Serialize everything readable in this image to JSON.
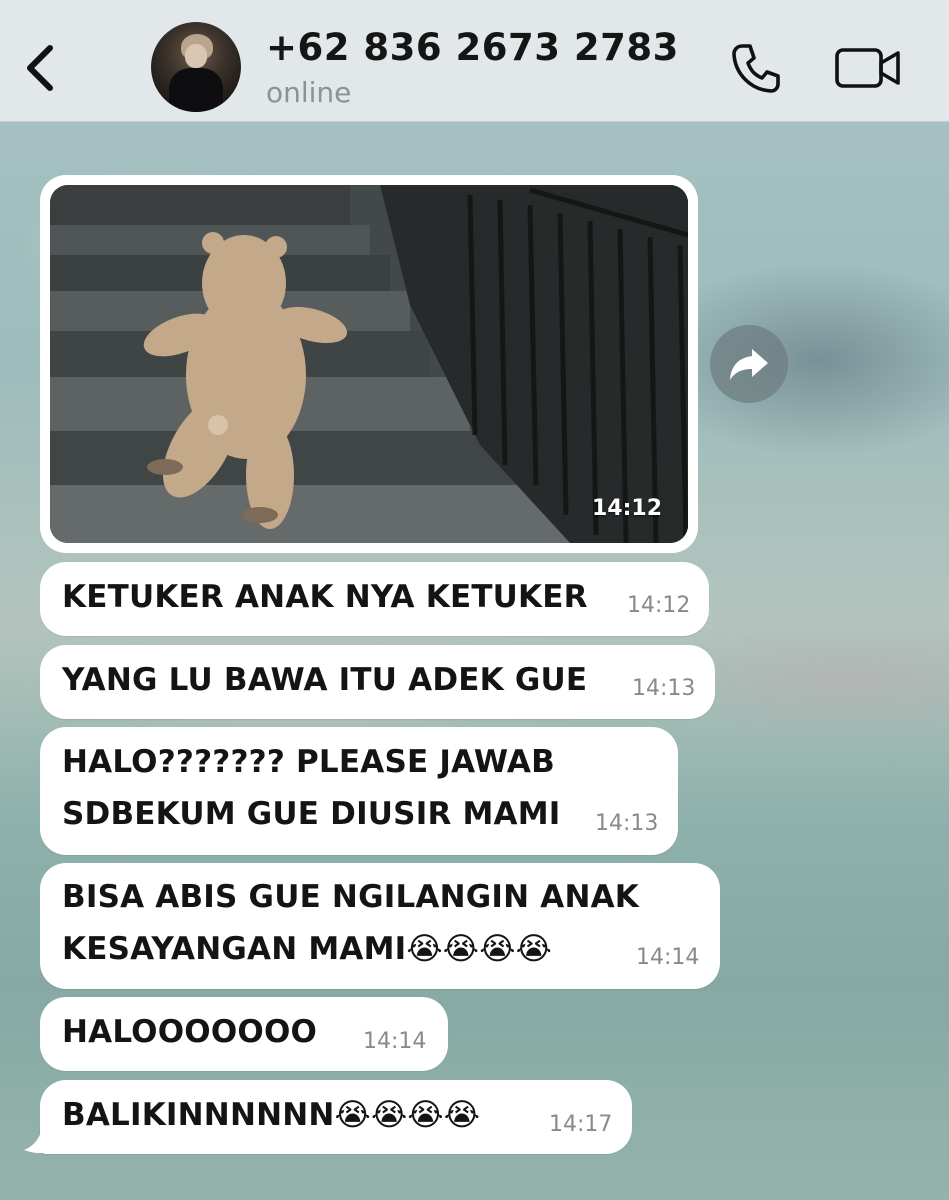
{
  "header": {
    "contact_name": "+62 836 2673 2783",
    "status": "online",
    "back_icon": "chevron-left-icon",
    "call_icon": "phone-icon",
    "video_icon": "video-camera-icon"
  },
  "colors": {
    "header_bg": "#e2e8ea",
    "bubble_bg": "#ffffff",
    "text": "#141414",
    "timestamp": "#8a8a8a"
  },
  "photo_message": {
    "time": "14:12",
    "forward_icon": "forward-icon"
  },
  "messages": [
    {
      "lines": [
        "KETUKER ANAK NYA KETUKER"
      ],
      "time": "14:12"
    },
    {
      "lines": [
        "YANG LU BAWA ITU ADEK GUE"
      ],
      "time": "14:13"
    },
    {
      "lines": [
        "HALO??????? PLEASE JAWAB",
        "SDBEKUM GUE DIUSIR MAMI"
      ],
      "time": "14:13"
    },
    {
      "lines": [
        "BISA ABIS GUE NGILANGIN ANAK",
        "KESAYANGAN MAMI😭😭😭😭"
      ],
      "time": "14:14"
    },
    {
      "lines": [
        "HALOOOOOOO"
      ],
      "time": "14:14"
    },
    {
      "lines": [
        "BALIKINNNNNN😭😭😭😭"
      ],
      "time": "14:17"
    }
  ]
}
